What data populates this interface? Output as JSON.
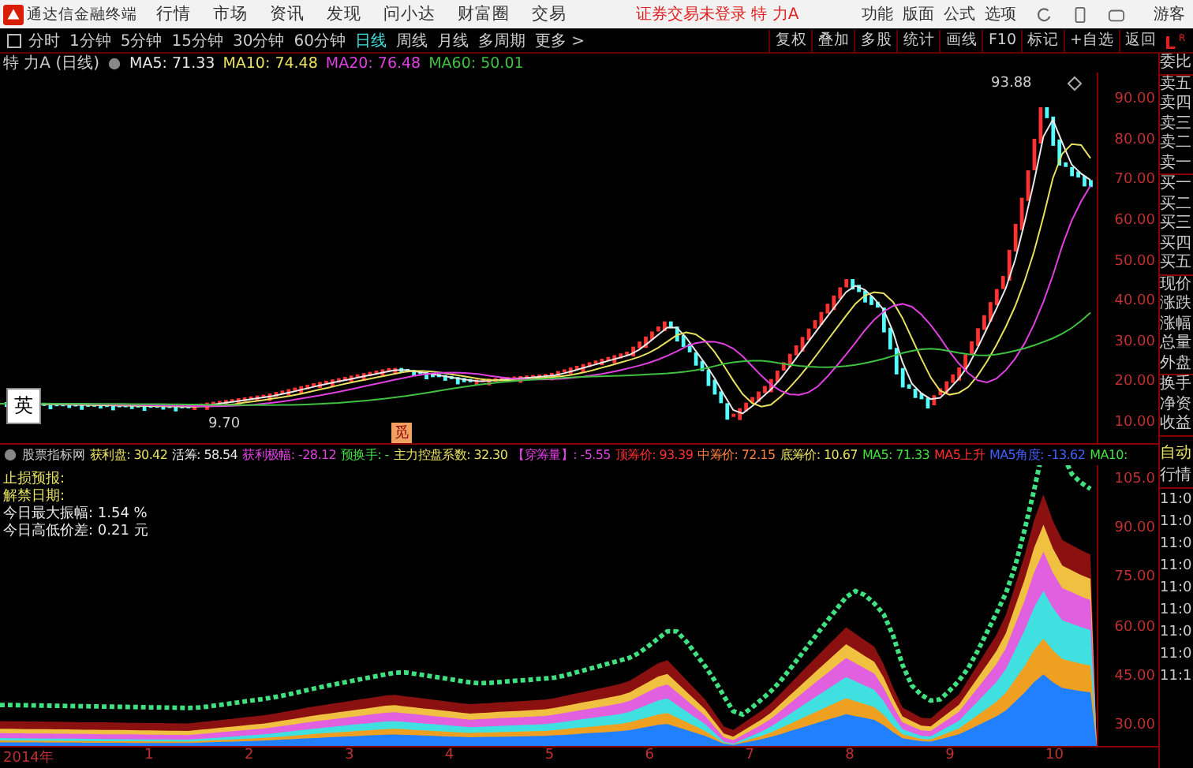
{
  "titlebar": {
    "app_name": "通达信金融终端",
    "menus": [
      "行情",
      "市场",
      "资讯",
      "发现",
      "问小达",
      "财富圈",
      "交易"
    ],
    "notice": "证券交易未登录  特 力A",
    "right_menus": [
      "功能",
      "版面",
      "公式",
      "选项"
    ],
    "user": "游客"
  },
  "periods": [
    {
      "label": "分时",
      "selected": false
    },
    {
      "label": "1分钟",
      "selected": false
    },
    {
      "label": "5分钟",
      "selected": false
    },
    {
      "label": "15分钟",
      "selected": false
    },
    {
      "label": "30分钟",
      "selected": false
    },
    {
      "label": "60分钟",
      "selected": false
    },
    {
      "label": "日线",
      "selected": true
    },
    {
      "label": "周线",
      "selected": false
    },
    {
      "label": "月线",
      "selected": false
    },
    {
      "label": "多周期",
      "selected": false
    },
    {
      "label": "更多 >",
      "selected": false
    }
  ],
  "level2_badge": {
    "big": "L",
    "small": "R"
  },
  "tools": [
    "复权",
    "叠加",
    "多股",
    "统计",
    "画线",
    "F10",
    "标记",
    "+自选",
    "返回"
  ],
  "legend": {
    "title": "特 力A (日线)",
    "items": [
      {
        "label": "MA5: 71.33",
        "color": "#e8e8e8"
      },
      {
        "label": "MA10: 74.48",
        "color": "#e8e060"
      },
      {
        "label": "MA20: 76.48",
        "color": "#e040e0"
      },
      {
        "label": "MA60: 50.01",
        "color": "#40c040"
      }
    ]
  },
  "main_chart": {
    "high_label": "93.88",
    "low_label": "9.70",
    "ime_label": "英",
    "marker_label": "觅",
    "price_axis": [
      "90.00",
      "80.00",
      "70.00",
      "60.00",
      "50.00",
      "40.00",
      "30.00",
      "20.00",
      "10.00"
    ]
  },
  "indicator": {
    "name": "股票指标网",
    "items": [
      {
        "label": "获利盘: 30.42",
        "color": "#e8e060"
      },
      {
        "label": "活筹: 58.54",
        "color": "#e8e8e8"
      },
      {
        "label": "获利极幅: -28.12",
        "color": "#e040e0"
      },
      {
        "label": "预换手: -",
        "color": "#40e040"
      },
      {
        "label": "主力控盘系数: 32.30",
        "color": "#e8e060"
      },
      {
        "label": "【穿筹量】: -5.55",
        "color": "#e040e0"
      },
      {
        "label": "顶筹价: 93.39",
        "color": "#ff3030"
      },
      {
        "label": "中筹价: 72.15",
        "color": "#ff8040"
      },
      {
        "label": "底筹价: 10.67",
        "color": "#e8e060"
      },
      {
        "label": "MA5: 71.33",
        "color": "#40e040"
      },
      {
        "label": "MA5上升",
        "color": "#ff3030"
      },
      {
        "label": "MA5角度: -13.62",
        "color": "#4060ff"
      },
      {
        "label": "MA10:",
        "color": "#40e040"
      }
    ],
    "notes": [
      {
        "text": "止损预报:",
        "color": "#e8e060"
      },
      {
        "text": "解禁日期:",
        "color": "#e8e060"
      },
      {
        "text": "今日最大振幅: 1.54 %",
        "color": "#e8e8e8"
      },
      {
        "text": "今日高低价差: 0.21 元",
        "color": "#e8e8e8"
      }
    ],
    "axis": [
      "105.0",
      "90.00",
      "75.00",
      "60.00",
      "45.00",
      "30.00"
    ]
  },
  "time_axis": [
    "2014年",
    "1",
    "2",
    "3",
    "4",
    "5",
    "6",
    "7",
    "8",
    "9",
    "10"
  ],
  "quote_panel": {
    "groups": [
      [
        "委比"
      ],
      [
        "卖五",
        "卖四",
        "卖三",
        "卖二",
        "卖一"
      ],
      [
        "买一",
        "买二",
        "买三",
        "买四",
        "买五"
      ],
      [
        "现价",
        "涨跌",
        "涨幅",
        "总量",
        "外盘"
      ],
      [
        "换手",
        "净资",
        "收益"
      ]
    ],
    "mode": "自动",
    "tab": "行情",
    "ticks": [
      "11:0",
      "11:0",
      "11:0",
      "11:0",
      "11:0",
      "11:0",
      "11:0",
      "11:0",
      "11:1"
    ]
  }
}
